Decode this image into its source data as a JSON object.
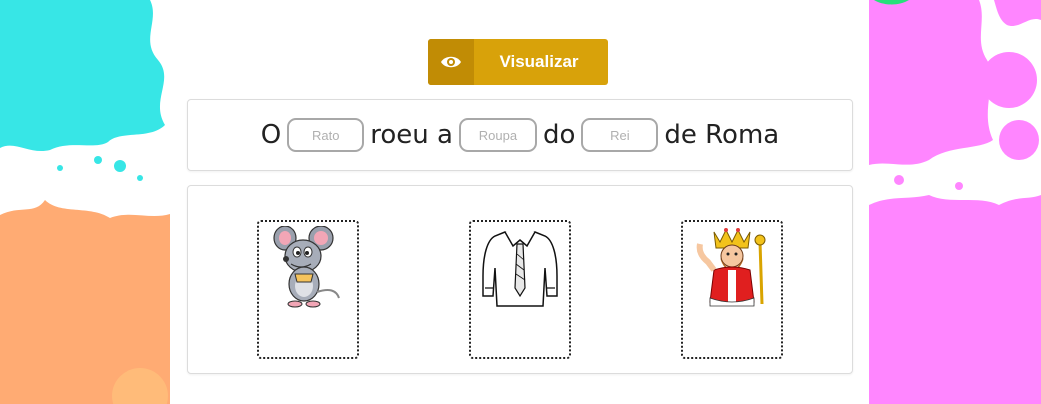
{
  "toolbar": {
    "view_label": "Visualizar",
    "view_icon": "eye-icon"
  },
  "sentence": {
    "words": [
      "O",
      "roeu a",
      "do",
      "de Roma"
    ],
    "blanks": [
      {
        "placeholder": "Rato"
      },
      {
        "placeholder": "Roupa"
      },
      {
        "placeholder": "Rei"
      }
    ]
  },
  "images": [
    "rat-image",
    "shirt-image",
    "king-image"
  ],
  "colors": {
    "button": "#d8a20a",
    "button_icon_bg": "#c18c05",
    "splash_cyan": "#37e6e6",
    "splash_orange": "#ffab73",
    "splash_pink": "#ff86ff",
    "splash_green": "#28e07a"
  }
}
